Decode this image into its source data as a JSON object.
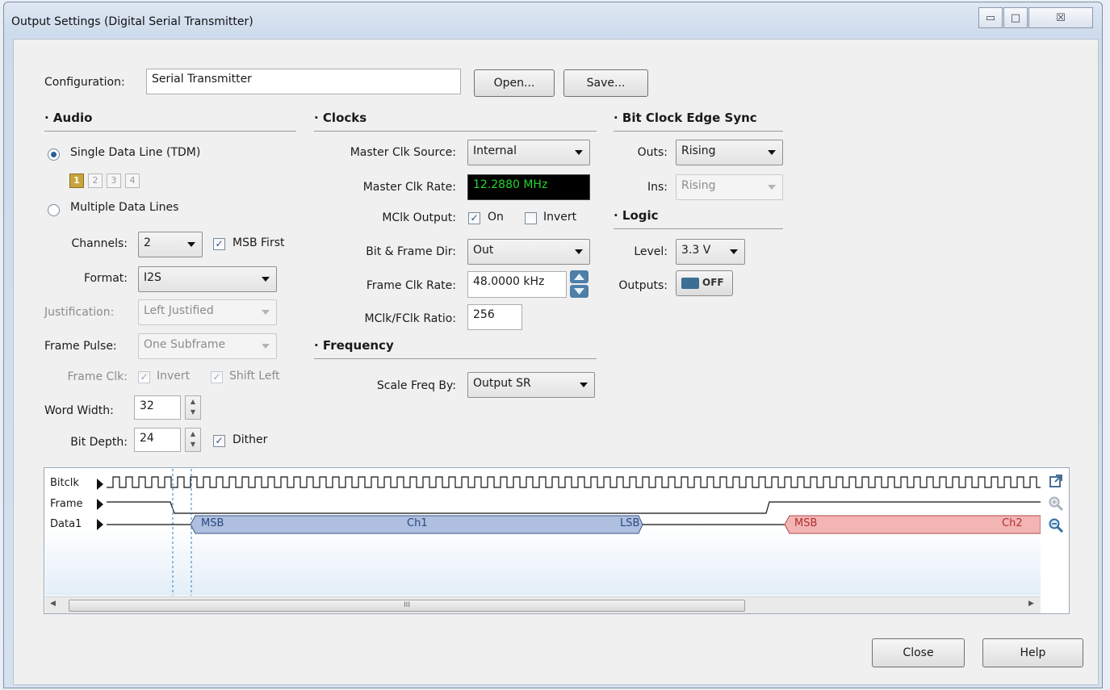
{
  "window": {
    "title": "Output Settings (Digital Serial Transmitter)",
    "controls": {
      "minimize": "▭",
      "maximize": "□",
      "close": "☒"
    }
  },
  "configuration": {
    "label": "Configuration:",
    "value": "Serial Transmitter",
    "open_button": "Open...",
    "save_button": "Save..."
  },
  "audio": {
    "header": "· Audio",
    "single_line": {
      "label": "Single Data Line (TDM)",
      "selected": true
    },
    "lanes": [
      "1",
      "2",
      "3",
      "4"
    ],
    "active_lane": "1",
    "multiple_lines": {
      "label": "Multiple Data Lines",
      "selected": false
    },
    "channels": {
      "label": "Channels:",
      "value": "2"
    },
    "msb_first": {
      "label": "MSB First",
      "checked": true
    },
    "format": {
      "label": "Format:",
      "value": "I2S"
    },
    "justification": {
      "label": "Justification:",
      "value": "Left Justified"
    },
    "frame_pulse": {
      "label": "Frame Pulse:",
      "value": "One Subframe"
    },
    "frame_clk": {
      "label": "Frame Clk:",
      "invert": "Invert",
      "shift_left": "Shift Left"
    },
    "word_width": {
      "label": "Word Width:",
      "value": "32"
    },
    "bit_depth": {
      "label": "Bit Depth:",
      "value": "24"
    },
    "dither": {
      "label": "Dither",
      "checked": true
    }
  },
  "clocks": {
    "header": "· Clocks",
    "master_clk_source": {
      "label": "Master Clk Source:",
      "value": "Internal"
    },
    "master_clk_rate": {
      "label": "Master Clk Rate:",
      "value": "12.2880 MHz",
      "color": "#22d62a",
      "bg": "#000000"
    },
    "mclk_output": {
      "label": "MClk Output:",
      "on": "On",
      "invert": "Invert",
      "on_checked": true,
      "invert_checked": false
    },
    "bit_frame_dir": {
      "label": "Bit & Frame Dir:",
      "value": "Out"
    },
    "frame_clk_rate": {
      "label": "Frame Clk Rate:",
      "value": "48.0000 kHz"
    },
    "mclk_fclk_ratio": {
      "label": "MClk/FClk Ratio:",
      "value": "256"
    }
  },
  "frequency": {
    "header": "· Frequency",
    "scale_freq_by": {
      "label": "Scale Freq By:",
      "value": "Output SR"
    }
  },
  "bit_clock_edge_sync": {
    "header": "· Bit Clock Edge Sync",
    "outs": {
      "label": "Outs:",
      "value": "Rising"
    },
    "ins": {
      "label": "Ins:",
      "value": "Rising"
    }
  },
  "logic": {
    "header": "· Logic",
    "level": {
      "label": "Level:",
      "value": "3.3 V"
    },
    "outputs": {
      "label": "Outputs:",
      "value": "OFF"
    }
  },
  "timing": {
    "signals": [
      "Bitclk",
      "Frame",
      "Data1"
    ],
    "ch1": {
      "msb": "MSB",
      "name": "Ch1",
      "lsb": "LSB",
      "color": "#aebfdf"
    },
    "ch2": {
      "msb": "MSB",
      "name": "Ch2",
      "color": "#f3b4b4"
    },
    "scroll_grip": "III",
    "tools": {
      "popout": "popout-icon",
      "zoom_in": "zoom-in-icon",
      "zoom_out": "zoom-out-icon"
    }
  },
  "footer": {
    "close_button": "Close",
    "help_button": "Help"
  }
}
